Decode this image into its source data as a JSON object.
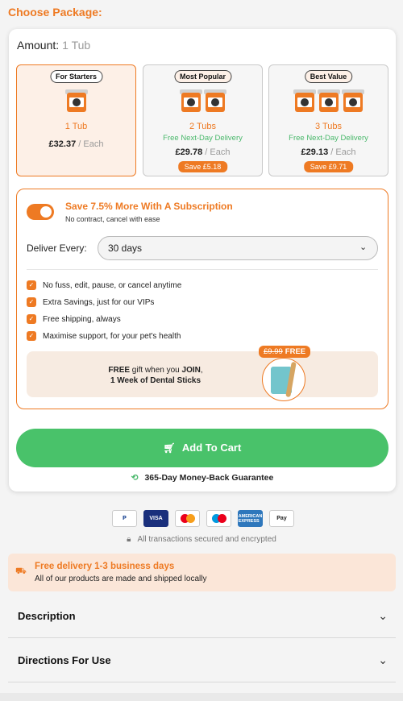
{
  "heading": "Choose Package:",
  "amount": {
    "label": "Amount:",
    "value": "1 Tub"
  },
  "packages": [
    {
      "badge": "For Starters",
      "qty": "1 Tub",
      "delivery": "",
      "price": "£32.37",
      "each": " / Each",
      "save": "",
      "selected": true
    },
    {
      "badge": "Most Popular",
      "qty": "2 Tubs",
      "delivery": "Free Next-Day Delivery",
      "price": "£29.78",
      "each": " / Each",
      "save": "Save £5.18",
      "selected": false
    },
    {
      "badge": "Best Value",
      "qty": "3 Tubs",
      "delivery": "Free Next-Day Delivery",
      "price": "£29.13",
      "each": " / Each",
      "save": "Save £9.71",
      "selected": false
    }
  ],
  "subscription": {
    "title": "Save 7.5% More With A Subscription",
    "note": "No contract, cancel with ease",
    "deliver_label": "Deliver Every:",
    "deliver_value": "30 days",
    "features": [
      "No fuss, edit, pause, or cancel anytime",
      "Extra Savings, just for our VIPs",
      "Free shipping, always",
      "Maximise support, for your pet's health"
    ],
    "gift": {
      "free_word": "FREE",
      "line1_rest": " gift when you ",
      "join_word": "JOIN",
      "line1_end": ",",
      "line2": "1 Week of Dental Sticks",
      "old_price": "£9.99",
      "free_label": "FREE"
    }
  },
  "cart": {
    "label": "Add To Cart"
  },
  "guarantee": "365-Day Money-Back Guarantee",
  "payments": [
    "P",
    "VISA",
    "",
    "",
    "AMERICAN EXPRESS",
    "Pay"
  ],
  "secure_text": "All transactions secured and encrypted",
  "delivery": {
    "title": "Free delivery 1-3 business days",
    "note": "All of our products are made and shipped locally"
  },
  "accordions": [
    "Description",
    "Directions For Use"
  ],
  "colors": {
    "accent": "#ee7a23",
    "green": "#49c26a"
  }
}
